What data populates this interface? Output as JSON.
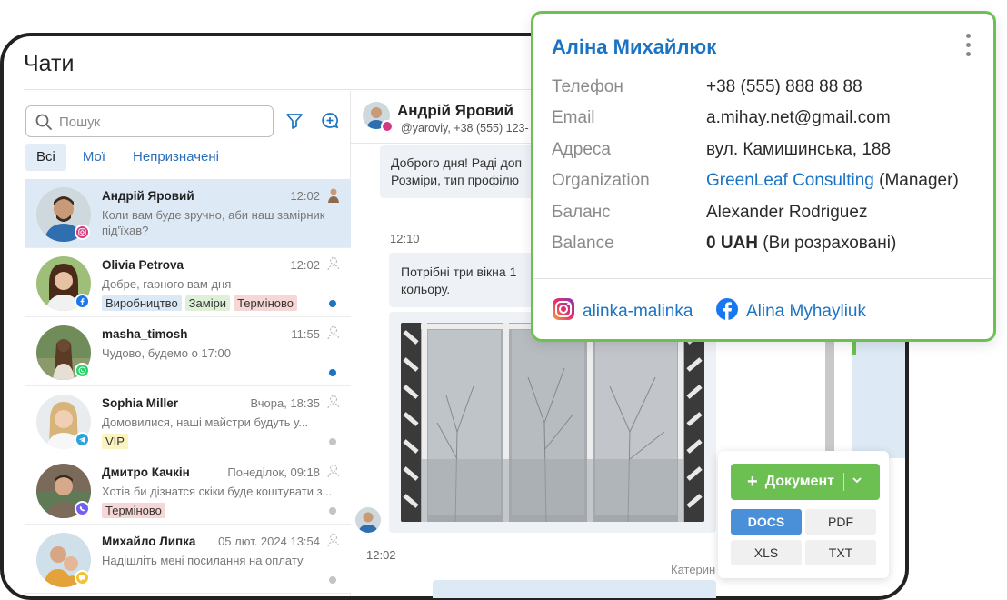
{
  "app": {
    "title": "Чати"
  },
  "sidebar": {
    "search_placeholder": "Пошук",
    "tabs": [
      {
        "label": "Всі"
      },
      {
        "label": "Мої"
      },
      {
        "label": "Непризначені"
      }
    ],
    "chats": [
      {
        "name": "Андрій Яровий",
        "time": "12:02",
        "preview": "Коли вам буде зручно, аби наш замірник під'їхав?",
        "channel": "instagram",
        "tags": []
      },
      {
        "name": "Olivia Petrova",
        "time": "12:02",
        "preview": "Добре, гарного вам дня",
        "channel": "facebook",
        "tags": [
          "Виробництво",
          "Заміри",
          "Терміново"
        ]
      },
      {
        "name": "masha_timosh",
        "time": "11:55",
        "preview": "Чудово, будемо о 17:00",
        "channel": "whatsapp",
        "tags": []
      },
      {
        "name": "Sophia Miller",
        "time": "Вчора, 18:35",
        "preview": "Домовилися, наші майстри будуть у...",
        "channel": "telegram",
        "tags": [
          "VIP"
        ]
      },
      {
        "name": "Дмитро Качкін",
        "time": "Понеділок, 09:18",
        "preview": "Хотів би дізнатся скіки буде коштувати з...",
        "channel": "viber",
        "tags": [
          "Терміново"
        ]
      },
      {
        "name": "Михайло Липка",
        "time": "05 лют. 2024 13:54",
        "preview": "Надішліть мені посилання на оплату",
        "channel": "other",
        "tags": []
      }
    ],
    "tag_colors": {
      "Виробництво": "#dbe8f5",
      "Заміри": "#dff0d8",
      "Терміново": "#f7d6d6",
      "VIP": "#fbf3c0"
    },
    "dot_colors": [
      "",
      "#1b73c4",
      "#1b73c4",
      "#c4c4c4",
      "#c4c4c4",
      "#c4c4c4"
    ]
  },
  "chat": {
    "header_name": "Андрій Яровий",
    "header_sub": "@yaroviy, +38 (555) 123-",
    "messages": [
      {
        "text": "Доброго дня! Раді доп\nРозміри, тип профілю"
      },
      {
        "time": "12:10"
      },
      {
        "text": "Потрібні три вікна 1\nкольору."
      },
      {
        "time": "12:02"
      },
      {
        "agent": "Катерин"
      }
    ]
  },
  "contact_card": {
    "name": "Аліна Михайлюк",
    "fields": [
      {
        "label": "Телефон",
        "value": "+38 (555) 888 88 88"
      },
      {
        "label": "Email",
        "value": "a.mihay.net@gmail.com"
      },
      {
        "label": "Адреса",
        "value": "вул. Камишинська, 188"
      },
      {
        "label": "Organization",
        "value_link": "GreenLeaf Consulting",
        "value_suffix": " (Manager)"
      },
      {
        "label": "Баланс",
        "value": "Alexander Rodriguez"
      },
      {
        "label": "Balance",
        "value_bold": "0 UAH",
        "value_suffix": " (Ви розраховані)"
      }
    ],
    "socials": [
      {
        "label": "alinka-malinka",
        "icon": "instagram-icon"
      },
      {
        "label": "Alina Myhayliuk",
        "icon": "facebook-icon"
      }
    ]
  },
  "document_panel": {
    "button_label": "Документ",
    "formats": [
      "DOCS",
      "PDF",
      "XLS",
      "TXT"
    ],
    "active_format": "DOCS"
  },
  "colors": {
    "accent_blue": "#1b73c4",
    "card_border_green": "#6cc051",
    "selected_row": "#dde9f5"
  }
}
